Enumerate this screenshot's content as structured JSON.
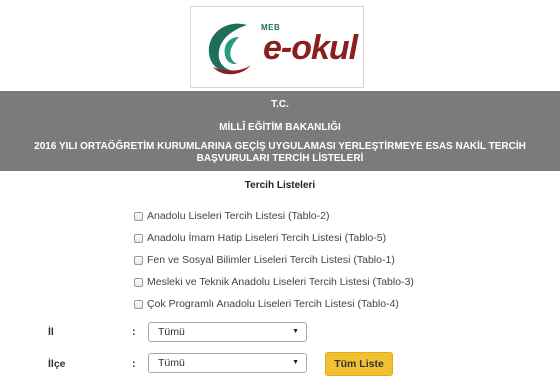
{
  "logo": {
    "meb": "MEB",
    "name": "e-okul"
  },
  "header": {
    "tc": "T.C.",
    "ministry": "MİLLÎ EĞİTİM BAKANLIĞI",
    "title_line1": "2016  YILI ORTAÖĞRETİM KURUMLARINA GEÇİŞ UYGULAMASI YERLEŞTİRMEYE ESAS NAKİL TERCİH",
    "title_line2": "BAŞVURULARI TERCİH LİSTELERİ"
  },
  "section": {
    "title": "Tercih Listeleri",
    "items": [
      {
        "label": "Anadolu Liseleri Tercih Listesi (Tablo-2)"
      },
      {
        "label": "Anadolu İmam Hatip Liseleri Tercih Listesi (Tablo-5)"
      },
      {
        "label": "Fen ve Sosyal Bilimler Liseleri Tercih Listesi (Tablo-1)"
      },
      {
        "label": "Mesleki ve Teknik Anadolu Liseleri Tercih Listesi (Tablo-3)"
      },
      {
        "label": "Çok Programlı Anadolu Liseleri Tercih Listesi (Tablo-4)"
      }
    ]
  },
  "filters": {
    "il_label": "İl",
    "ilce_label": "İlçe",
    "colon": ":",
    "il_value": "Tümü",
    "ilce_value": "Tümü"
  },
  "actions": {
    "all_list": "Tüm Liste"
  },
  "colors": {
    "header_bg": "#7b7b7b",
    "button_bg": "#f2c131",
    "logo_red": "#8b1e1e",
    "logo_green": "#1f6e5a"
  },
  "icons": {
    "select_arrow": "chevron-down-icon",
    "checkbox": "checkbox-icon"
  }
}
